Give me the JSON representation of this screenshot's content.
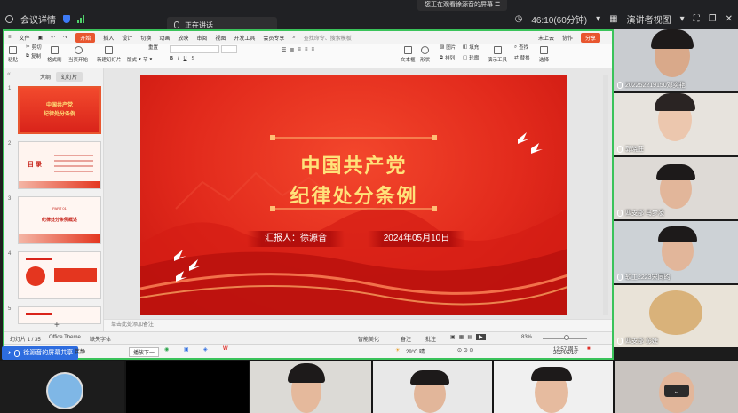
{
  "topbar": {
    "meeting_details": "会议详情",
    "watching_banner": "您正在观看徐源音的屏幕",
    "speaking_label": "正在讲话",
    "timer": "46:10(60分钟)",
    "view_mode": "演讲者视图"
  },
  "menubar": {
    "items": [
      "文件",
      "开始",
      "插入",
      "设计",
      "切换",
      "动画",
      "放映",
      "审阅",
      "视图",
      "开发工具",
      "会员专享"
    ],
    "search_placeholder": "查找命令、搜索模板",
    "uncloud": "未上云",
    "collab": "协作",
    "share": "分享"
  },
  "ribbon": {
    "paste": "粘贴",
    "cut": "剪切",
    "copy": "复制",
    "format_painter": "格式刷",
    "play_from_current": "当页开始",
    "new_slide": "新建幻灯片",
    "layout": "版式",
    "section": "节",
    "reset": "重置",
    "textbox": "文本框",
    "shape": "形状",
    "picture": "图片",
    "arrange": "排列",
    "fill": "填充",
    "outline": "轮廓",
    "slide_tools": "演示工具",
    "find": "查找",
    "replace": "替换",
    "select": "选择"
  },
  "thumbs": {
    "tab_outline": "大纲",
    "tab_slides": "幻灯片",
    "numbers": [
      "1",
      "2",
      "3",
      "4",
      "5"
    ],
    "slide1_title": "中国共产党",
    "slide1_sub": "纪律处分条例",
    "slide2_title": "目 录",
    "slide3_label": "PART 01",
    "slide3_title": "纪律处分条例概述"
  },
  "slide": {
    "title_line1": "中国共产党",
    "title_line2": "纪律处分条例",
    "reporter": "汇报人：徐源音",
    "date": "2024年05月10日"
  },
  "notes_placeholder": "单击此处添加备注",
  "status": {
    "slide_count": "幻灯片 1 / 35",
    "theme": "Office Theme",
    "font_missing": "缺失字体",
    "smart_beautify": "智能美化",
    "notes": "备注",
    "comments": "批注",
    "zoom": "83%"
  },
  "taskbar": {
    "next_btn": "播放下一",
    "weather": "29°C 晴",
    "time": "12:57 周五",
    "date": "2024/5/10"
  },
  "share_label": "徐源音的屏幕共享",
  "participants": [
    {
      "name": "2022522191​50邓奕艳"
    },
    {
      "name": "郭晓莊"
    },
    {
      "name": "四支部 马梦凌"
    },
    {
      "name": "软工2223宋同昀"
    },
    {
      "name": "四支部 彭婕"
    }
  ],
  "bottom": {
    "extra_name": "芪静"
  },
  "colors": {
    "accent": "#e8562f",
    "slide_red": "#e22a1c",
    "title_gold": "#ffe27a",
    "border_green": "#3ac35a"
  }
}
